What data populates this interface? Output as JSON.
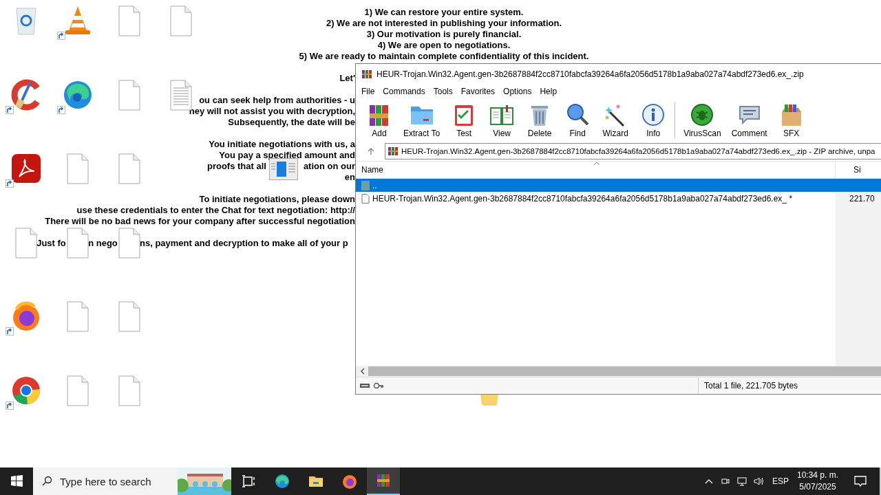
{
  "desktop": {
    "icons": [
      {
        "kind": "recycle-bin",
        "shortcut": false
      },
      {
        "kind": "ccleaner",
        "shortcut": true
      },
      {
        "kind": "acrobat",
        "shortcut": true
      },
      {
        "kind": "file",
        "shortcut": false
      },
      {
        "kind": "firefox",
        "shortcut": true
      },
      {
        "kind": "chrome",
        "shortcut": true
      },
      {
        "kind": "vlc",
        "shortcut": true
      },
      {
        "kind": "edge",
        "shortcut": true
      },
      {
        "kind": "file",
        "shortcut": false
      },
      {
        "kind": "file",
        "shortcut": false
      },
      {
        "kind": "file",
        "shortcut": false
      },
      {
        "kind": "file",
        "shortcut": false
      },
      {
        "kind": "file",
        "shortcut": false
      },
      {
        "kind": "file",
        "shortcut": false
      },
      {
        "kind": "file",
        "shortcut": false
      },
      {
        "kind": "file",
        "shortcut": false
      },
      {
        "kind": "file",
        "shortcut": false
      },
      {
        "kind": "file",
        "shortcut": false
      },
      {
        "kind": "file",
        "shortcut": false
      },
      {
        "kind": "text-file",
        "shortcut": false
      }
    ],
    "dragged_icon": {
      "kind": "window"
    },
    "peeking_icon": {
      "kind": "folder"
    }
  },
  "note": {
    "paragraphs": [
      {
        "kind": "full",
        "lines": [
          {
            "parts": [
              "1) We can restore your entire system."
            ]
          },
          {
            "parts": [
              "2) We are not interested in publishing your information."
            ]
          },
          {
            "parts": [
              "3) Our motivation is purely financial."
            ]
          },
          {
            "parts": [
              "4) We are open to negotiations."
            ]
          },
          {
            "parts": [
              "5) We are ready to maintain complete confidentiality of this incident."
            ]
          }
        ]
      },
      {
        "kind": "cut",
        "lines": [
          {
            "parts": [
              "Let'"
            ]
          }
        ]
      },
      {
        "kind": "cut",
        "lines": [
          {
            "parts": [
              "ou can seek help from authorities - u"
            ]
          },
          {
            "parts": [
              "hey will not assist you with decryption,"
            ]
          },
          {
            "parts": [
              "Subsequently, the date will be"
            ]
          }
        ]
      },
      {
        "kind": "cut",
        "lines": [
          {
            "parts": [
              "You initiate negotiations with us, a"
            ]
          },
          {
            "parts": [
              "You pay a specified amount and"
            ]
          },
          {
            "parts": [
              "proofs that all",
              "ation on our"
            ]
          },
          {
            "parts": [
              "en"
            ]
          }
        ]
      },
      {
        "kind": "cut",
        "lines": [
          {
            "parts": [
              "To initiate negotiations, please down"
            ]
          },
          {
            "parts": [
              "use these credentials to enter the Chat for text negotiation: http://"
            ]
          },
          {
            "parts": [
              "There will be no bad news for your company after successful negotiation"
            ]
          }
        ]
      },
      {
        "kind": "icon-row",
        "lines": [
          {
            "parts": [
              "Just fo",
              "n nego",
              "ns, payment and decryption to make all of your p"
            ]
          }
        ]
      }
    ]
  },
  "window": {
    "title": "HEUR-Trojan.Win32.Agent.gen-3b2687884f2cc8710fabcfa39264a6fa2056d5178b1a9aba027a74abdf273ed6.ex_.zip",
    "menu": [
      "File",
      "Commands",
      "Tools",
      "Favorites",
      "Options",
      "Help"
    ],
    "toolbar_groups": [
      [
        {
          "label": "Add",
          "kind": "add"
        },
        {
          "label": "Extract To",
          "kind": "extract"
        },
        {
          "label": "Test",
          "kind": "test"
        },
        {
          "label": "View",
          "kind": "view"
        },
        {
          "label": "Delete",
          "kind": "delete"
        },
        {
          "label": "Find",
          "kind": "find"
        },
        {
          "label": "Wizard",
          "kind": "wizard"
        },
        {
          "label": "Info",
          "kind": "info"
        }
      ],
      [
        {
          "label": "VirusScan",
          "kind": "virusscan"
        },
        {
          "label": "Comment",
          "kind": "comment"
        },
        {
          "label": "SFX",
          "kind": "sfx"
        }
      ]
    ],
    "address": "HEUR-Trojan.Win32.Agent.gen-3b2687884f2cc8710fabcfa39264a6fa2056d5178b1a9aba027a74abdf273ed6.ex_.zip - ZIP archive, unpa",
    "columns": [
      "Name",
      "Si"
    ],
    "rows": [
      {
        "kind": "parent",
        "name": "..",
        "selected": true
      },
      {
        "kind": "file",
        "name": "HEUR-Trojan.Win32.Agent.gen-3b2687884f2cc8710fabcfa39264a6fa2056d5178b1a9aba027a74abdf273ed6.ex_ *",
        "size": "221.70",
        "selected": false
      }
    ],
    "status": "Total 1 file, 221.705 bytes"
  },
  "taskbar": {
    "search": {
      "placeholder": "Type here to search"
    },
    "apps": [
      {
        "kind": "task-view",
        "selected": false
      },
      {
        "kind": "edge",
        "selected": false
      },
      {
        "kind": "explorer",
        "selected": false
      },
      {
        "kind": "firefox",
        "selected": false
      },
      {
        "kind": "winrar",
        "selected": true
      }
    ],
    "language": "ESP",
    "time": "10:34 p. m.",
    "date": "5/07/2025"
  }
}
